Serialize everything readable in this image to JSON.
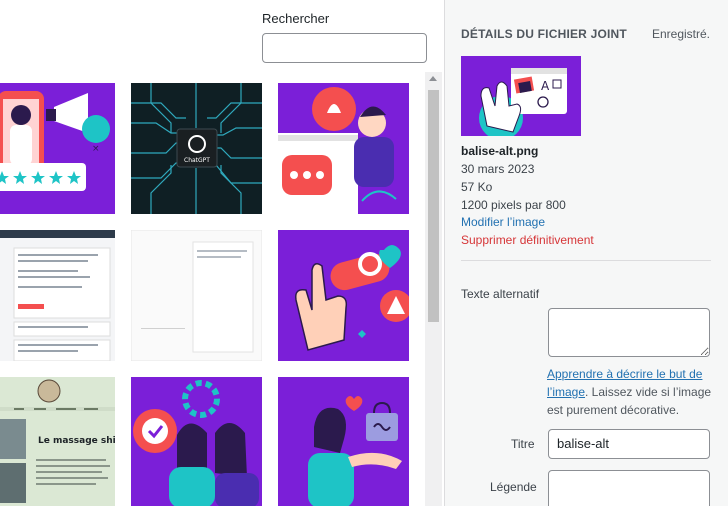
{
  "search": {
    "label": "Rechercher",
    "value": ""
  },
  "details": {
    "heading": "DÉTAILS DU FICHIER JOINT",
    "status": "Enregistré.",
    "file_name": "balise-alt.png",
    "date": "30 mars 2023",
    "size": "57 Ko",
    "dimensions": "1200 pixels par 800",
    "edit_link": "Modifier l’image",
    "delete_link": "Supprimer définitivement"
  },
  "fields": {
    "alt_label": "Texte alternatif",
    "alt_value": "",
    "help_link": "Apprendre à décrire le but de l’image",
    "help_text": ". Laissez vide si l’image est purement décorative.",
    "title_label": "Titre",
    "title_value": "balise-alt",
    "caption_label": "Légende",
    "caption_value": ""
  },
  "thumb_texts": {
    "chatgpt": "ChatGPT",
    "massage": "Le massage shiatsu"
  },
  "colors": {
    "purple": "#7b1fd8",
    "teal": "#1ec4c6",
    "red": "#f44f4f",
    "link": "#2271b1",
    "danger": "#d63638"
  }
}
